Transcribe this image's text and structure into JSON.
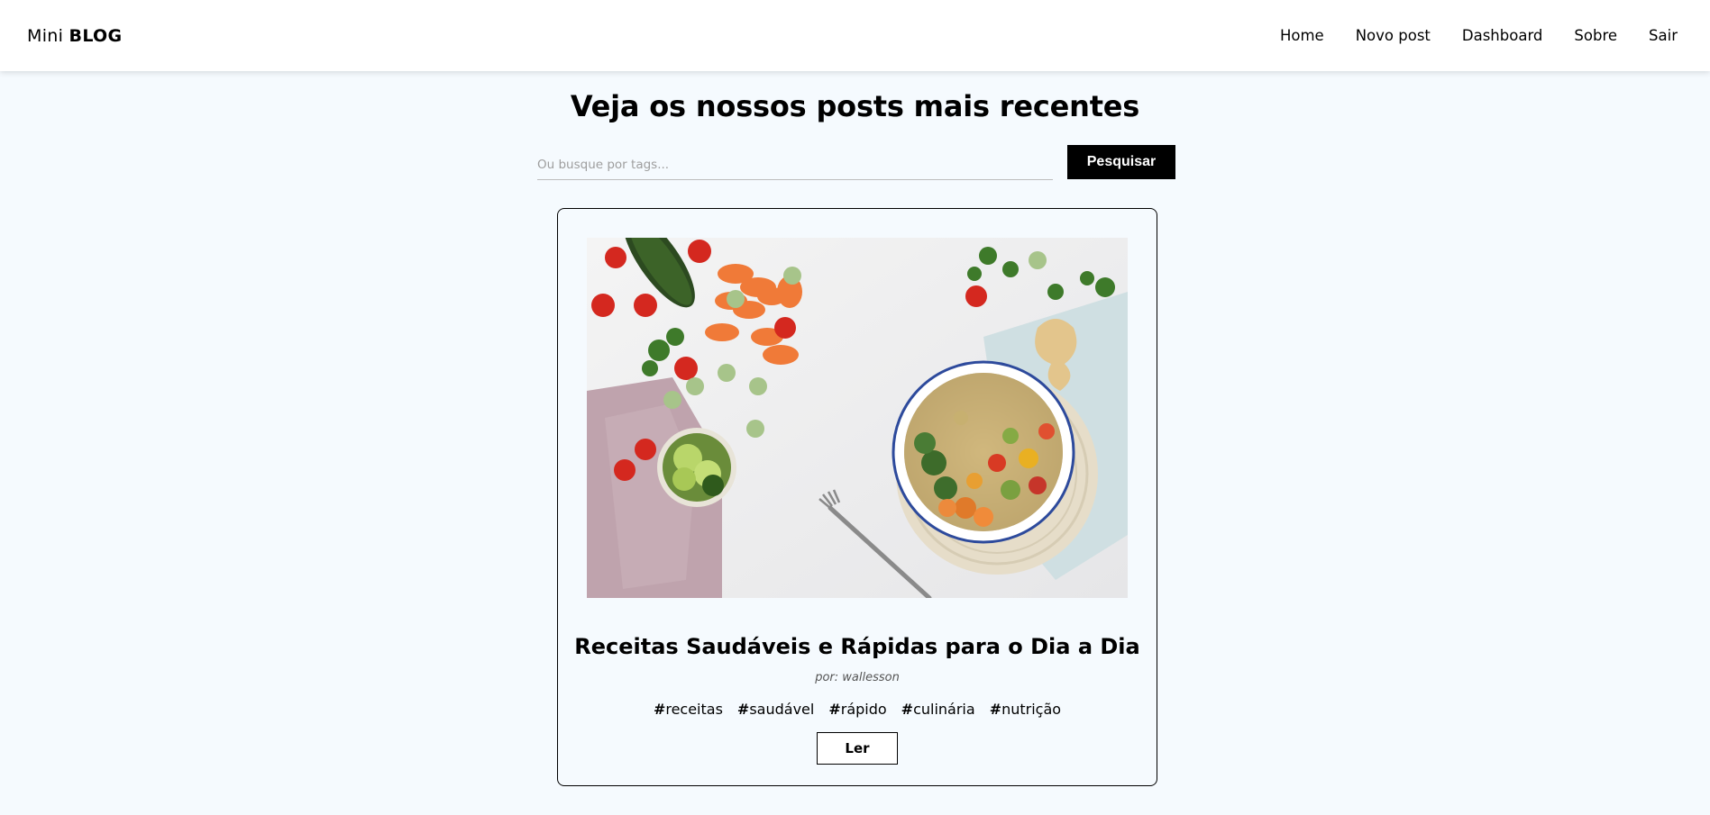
{
  "brand": {
    "prefix": "Mini",
    "bold": "BLOG"
  },
  "nav": {
    "items": [
      {
        "label": "Home"
      },
      {
        "label": "Novo post"
      },
      {
        "label": "Dashboard"
      },
      {
        "label": "Sobre"
      },
      {
        "label": "Sair"
      }
    ]
  },
  "page": {
    "title": "Veja os nossos posts mais recentes"
  },
  "search": {
    "placeholder": "Ou busque por tags...",
    "value": "",
    "button_label": "Pesquisar"
  },
  "posts": [
    {
      "title": "Receitas Saudáveis e Rápidas para o Dia a Dia",
      "author": "por: wallesson",
      "tags": [
        "receitas",
        "saudável",
        "rápido",
        "culinária",
        "nutrição"
      ],
      "read_label": "Ler",
      "image": "healthy-food-bowl-photo"
    }
  ]
}
